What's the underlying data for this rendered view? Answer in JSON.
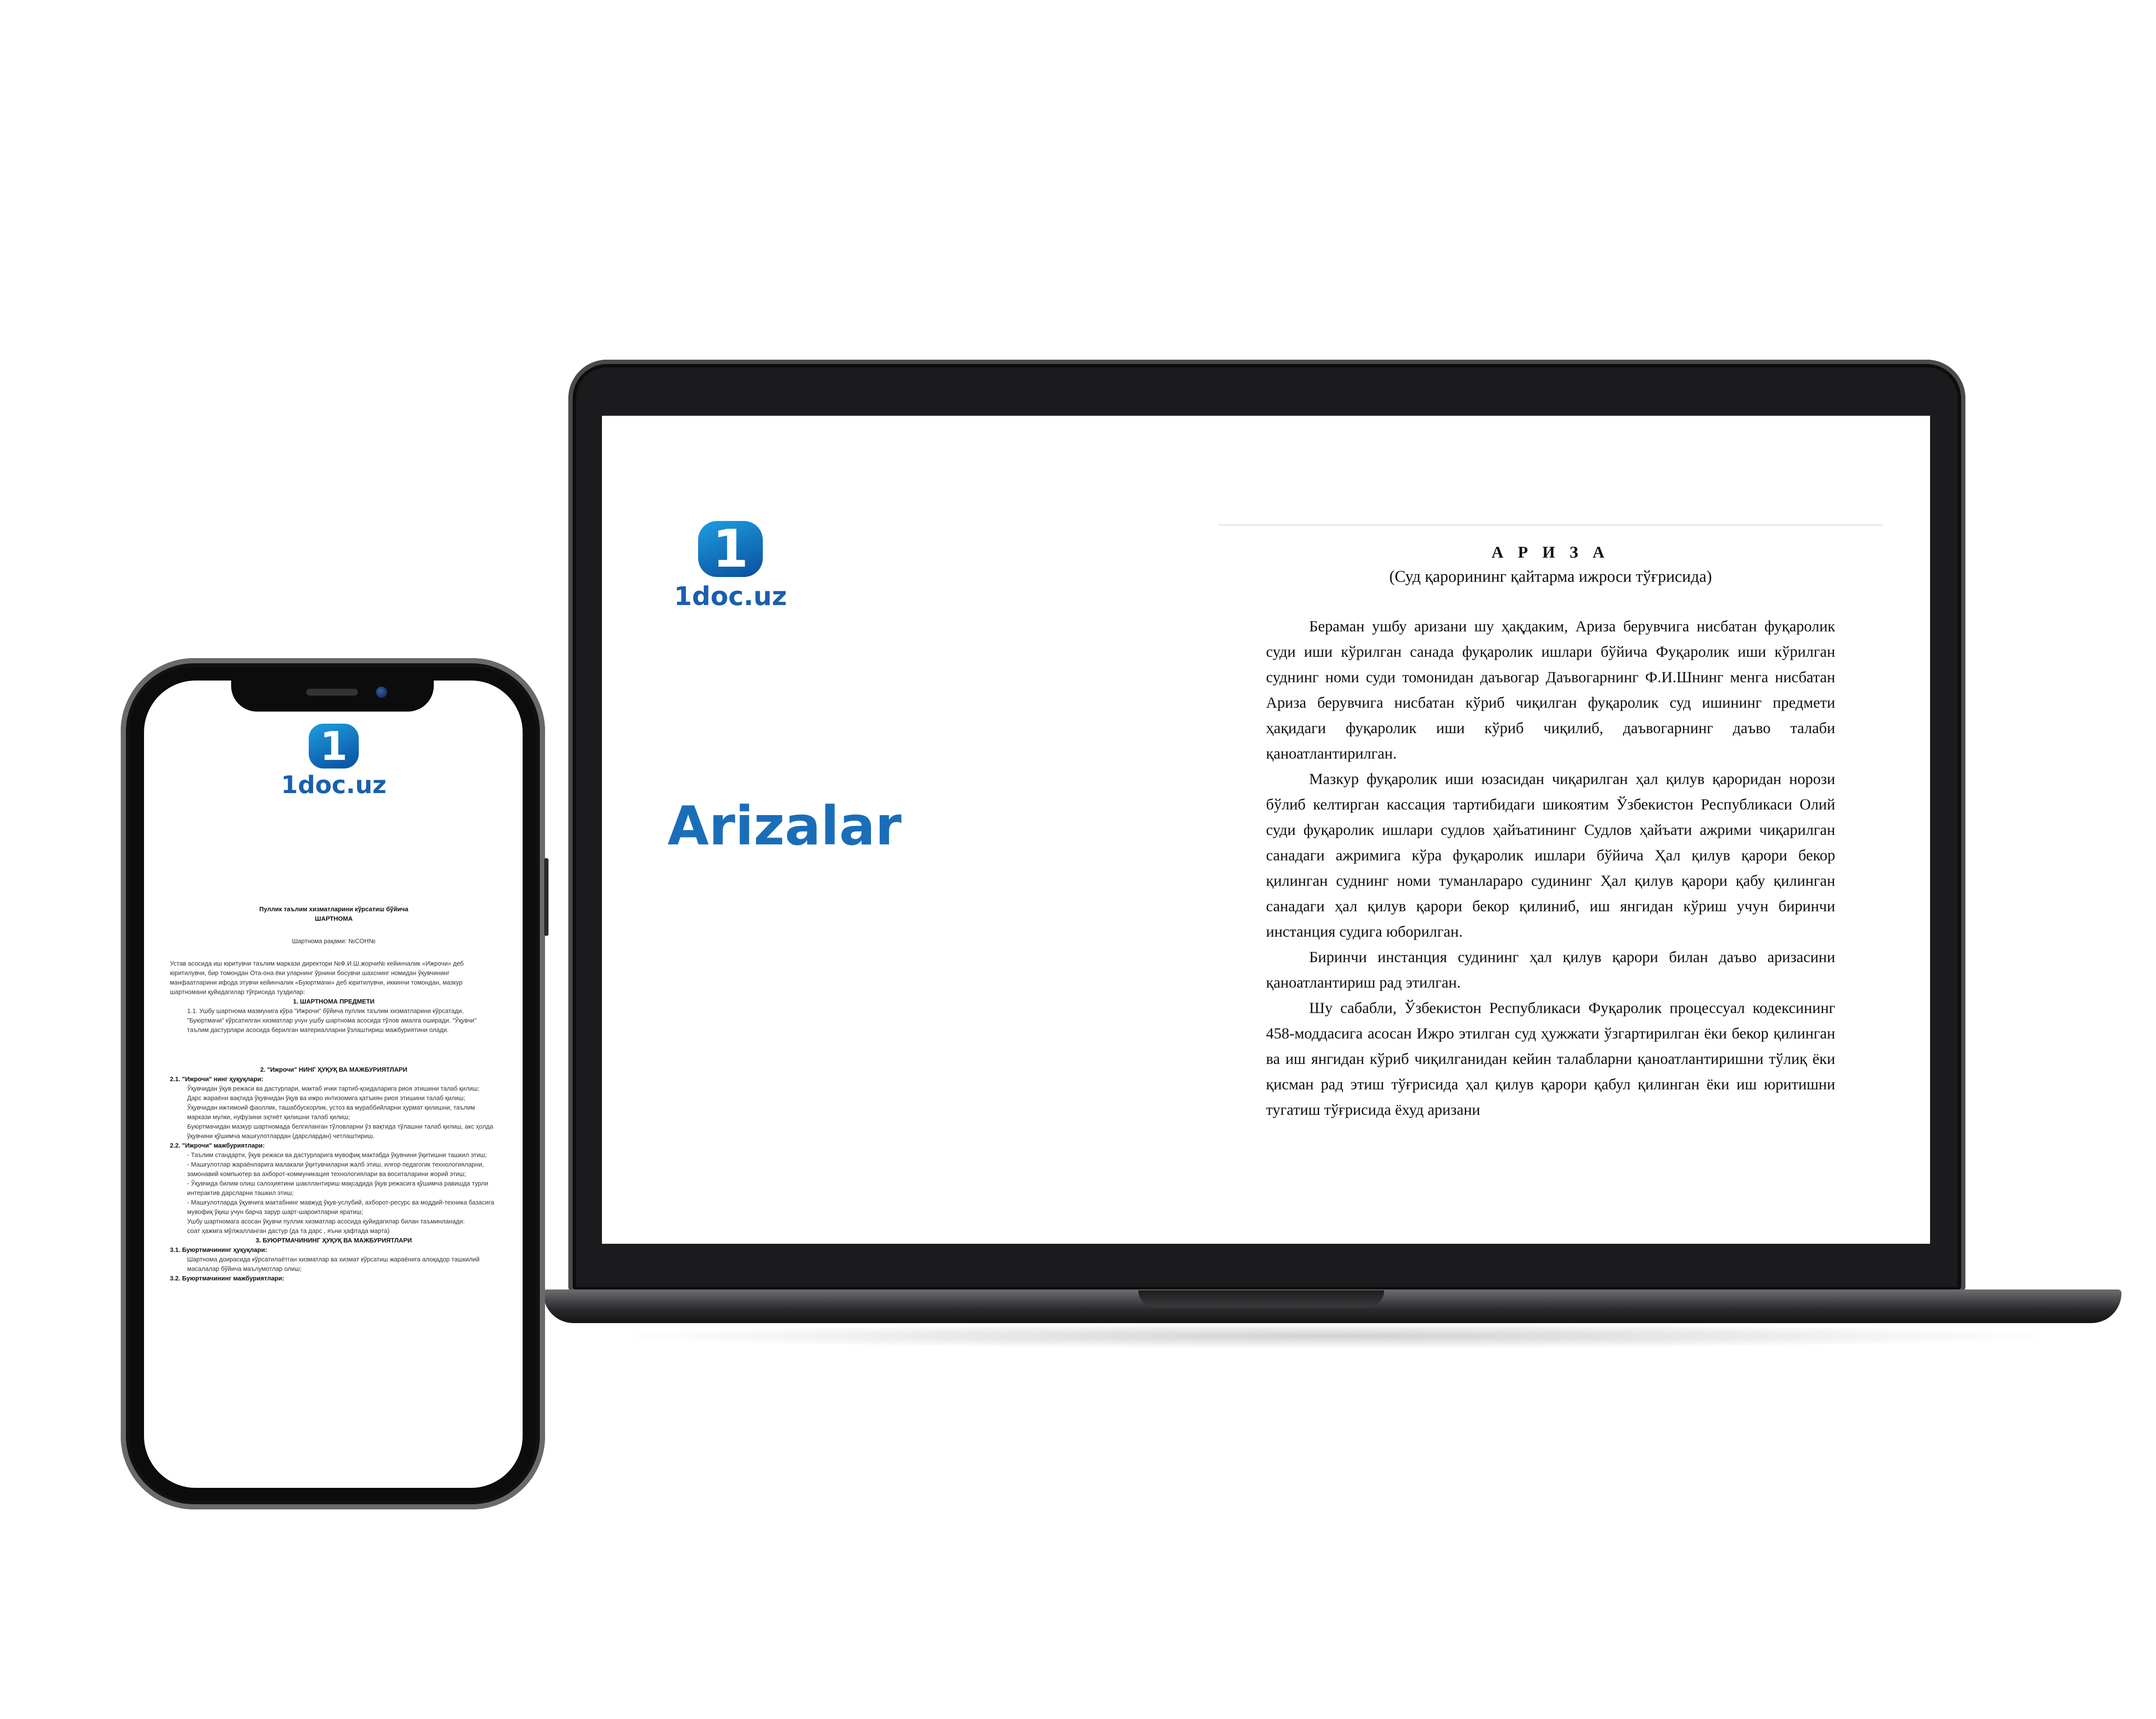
{
  "brand": {
    "logo_digit": "1",
    "logo_text": "1doc.uz",
    "accent": "#1a6eb8"
  },
  "laptop": {
    "section_title": "Arizalar",
    "doc": {
      "title": "А Р И З А",
      "subtitle": "(Суд қарорининг қайтарма ижроси тўғрисида)",
      "paragraphs": [
        "Бераман ушбу аризани шу ҳақдаким, Ариза берувчига нисбатан фуқаролик суди иши кўрилган санада фуқаролик ишлари бўйича Фуқаролик иши кўрилган суднинг номи суди томонидан даъвогар Даъвогарнинг Ф.И.Шнинг менга нисбатан Ариза берувчига нисбатан кўриб чиқилган фуқаролик суд ишининг предмети ҳақидаги фуқаролик иши кўриб чиқилиб, даъвогарнинг даъво талаби қаноатлантирилган.",
        "Мазкур фуқаролик иши юзасидан чиқарилган ҳал қилув қароридан норози бўлиб келтирган кассация тартибидаги шикоятим Ўзбекистон Республикаси Олий суди фуқаролик ишлари судлов ҳайъатининг Судлов ҳайъати ажрими чиқарилган санадаги ажримига кўра фуқаролик ишлари бўйича Ҳал қилув қарори бекор қилинган суднинг номи туманлараро судининг Ҳал қилув қарори қабу қилинган санадаги ҳал қилув қарори бекор қилиниб, иш янгидан кўриш учун биринчи инстанция судига юборилган.",
        "Биринчи инстанция судининг ҳал қилув қарори билан даъво аризасини қаноатлантириш рад этилган.",
        "Шу сабабли, Ўзбекистон Республикаси Фуқаролик процессуал кодексининг 458-моддасига асосан Ижро этилган суд ҳужжати ўзгартирилган ёки бекор қилинган ва иш янгидан кўриб чиқилганидан кейин талабларни қаноатлантиришни тўлиқ ёки қисман рад этиш тўғрисида ҳал қилув қарори қабул қилинган ёки иш юритишни тугатиш тўғрисида ёхуд аризани"
      ]
    }
  },
  "phone": {
    "doc_lines": [
      {
        "t": "Пуллик таълим хизматларини кўрсатиш бўйича",
        "s": "c b"
      },
      {
        "t": "ШАРТНОМА",
        "s": "c b"
      },
      {
        "t": "",
        "s": "sgap"
      },
      {
        "t": "Шартнома рақами: №СОН№",
        "s": "c"
      },
      {
        "t": "",
        "s": "sgap"
      },
      {
        "t": "Устав асосида иш юритувчи таълим маркази директори №Ф.И.Ш.жорчи№ кейинчалик «Ижрочи» деб юритилувчи, бир томондан Ота-она ёки уларнинг ўрнини босувчи шахснинг номидан ўқувчининг манфаатларини ифода этувчи кейинчалик «Буюртмачи» деб юритилувчи, иккинчи томондан, мазкур шартномани қуйидагилар тўғрисида туздилар:",
        "s": ""
      },
      {
        "t": "1. ШАРТНОМА ПРЕДМЕТИ",
        "s": "c b"
      },
      {
        "t": "1.1. Ушбу шартнома мазмунига кўра \"Ижрочи\" бўйича пуллик таълим хизматларини кўрсатади, \"Буюртмачи\" кўрсатилган хизматлар учун ушбу шартнома асосида тўлов амалга оширади. \"Ўқувчи\" таълим дастурлари асосида берилган материалларни ўзлаштириш мажбуриятини олади.",
        "s": "i"
      },
      {
        "t": "",
        "s": "gap"
      },
      {
        "t": "2. \"Ижрочи\" НИНГ ҲУҚУҚ ВА МАЖБУРИЯТЛАРИ",
        "s": "c b"
      },
      {
        "t": "2.1. \"Ижрочи\" нинг ҳуқуқлари:",
        "s": "b"
      },
      {
        "t": "Ўқувчидан ўқув режаси ва дастурлари, мактаб ички тартиб-қоидаларига риоя этишини талаб қилиш;",
        "s": "i"
      },
      {
        "t": "Дарс жараёни вақтида ўқувчидан ўқув ва ижро интизомига қатъиян риоя этишини талаб қилиш;",
        "s": "i"
      },
      {
        "t": "Ўқувчидан ижтимоий фаоллик, ташаббускорлик, устоз ва мураббийларни ҳурмат қилишни, таълим маркази мулки, нуфузини эҳтиёт қилишни талаб қилиш;",
        "s": "i"
      },
      {
        "t": "Буюртмачидан мазкур шартномада белгиланган тўловларни ўз вақтида тўлашни талаб қилиш, акс ҳолда ўқувчини қўшимча машғулотлардан (дарслардан) четлаштириш.",
        "s": "i"
      },
      {
        "t": "2.2. \"Ижрочи\" мажбуриятлари:",
        "s": "b"
      },
      {
        "t": "- Таълим стандарти, ўқув режаси ва дастурларига мувофиқ мактабда ўқувчини ўқитишни ташкил этиш;",
        "s": "i"
      },
      {
        "t": "- Машғулотлар жараёнларига малакали ўқитувчиларни жалб этиш, илғор педагогик технологияларни, замонавий компьютер ва ахборот-коммуникация технологиялари ва воситаларини жорий этиш;",
        "s": "i"
      },
      {
        "t": "- Ўқувчида билим олиш салоҳиятини шакллантириш мақсадида ўқув режасига қўшимча равишда турли интерактив дарсларни ташкил этиш;",
        "s": "i"
      },
      {
        "t": "- Машғулотларда ўқувчига мактабнинг мавжуд ўқув-услубий, ахборот-ресурс ва моддий-техника базасига мувофиқ ўқиш учун барча зарур шарт-шароитларни яратиш;",
        "s": "i"
      },
      {
        "t": "Ушбу шартномага асосан ўқувчи пуллик хизматлар асосида қуйидагилар билан таъминланади:",
        "s": "i"
      },
      {
        "t": "соат ҳажмга мўлжалланган дастур (да та дарс , яъни ҳафтада марта)",
        "s": "i"
      },
      {
        "t": "3. БУЮРТМАЧИНИНГ ҲУҚУҚ ВА МАЖБУРИЯТЛАРИ",
        "s": "c b"
      },
      {
        "t": "3.1. Буюртмачининг ҳуқуқлари:",
        "s": "b"
      },
      {
        "t": "Шартнома доирасида кўрсатилаётган хизматлар ва хизмат кўрсатиш жараёнига алоқадор ташкилий масалалар бўйича маълумотлар олиш;",
        "s": "i"
      },
      {
        "t": "3.2. Буюртмачининг мажбуриятлари:",
        "s": "b"
      }
    ]
  }
}
